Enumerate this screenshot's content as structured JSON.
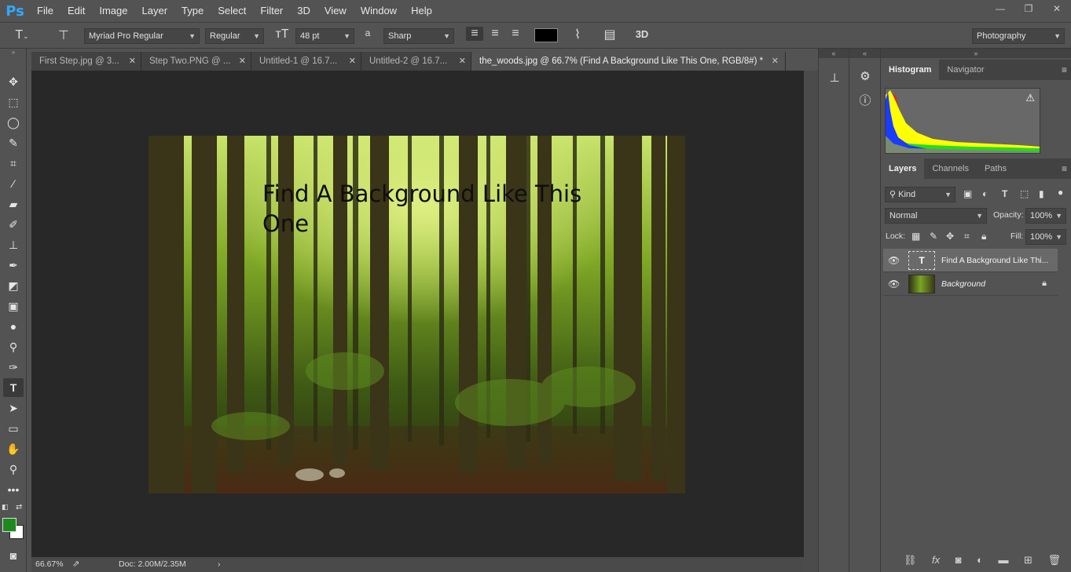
{
  "app": {
    "logo": "Ps"
  },
  "menu": [
    "File",
    "Edit",
    "Image",
    "Layer",
    "Type",
    "Select",
    "Filter",
    "3D",
    "View",
    "Window",
    "Help"
  ],
  "window_controls": {
    "minimize": "—",
    "restore": "❐",
    "close": "✕"
  },
  "options_bar": {
    "font_family": "Myriad Pro Regular",
    "font_style": "Regular",
    "font_size": "48 pt",
    "antialias_icon_label": "a",
    "antialias": "Sharp",
    "text_color": "#000000",
    "workspace": "Photography",
    "three_d": "3D"
  },
  "tabs": [
    {
      "label": "First Step.jpg @ 3...",
      "active": false
    },
    {
      "label": "Step Two.PNG @ ...",
      "active": false
    },
    {
      "label": "Untitled-1 @ 16.7...",
      "active": false
    },
    {
      "label": "Untitled-2 @ 16.7...",
      "active": false
    },
    {
      "label": "the_woods.jpg @ 66.7% (Find A Background Like This One, RGB/8#) *",
      "active": true
    }
  ],
  "document": {
    "text_line1": "Find A Background Like This",
    "text_line2": "One"
  },
  "status": {
    "zoom": "66.67%",
    "doc": "Doc: 2.00M/2.35M"
  },
  "panels": {
    "top_tabs": [
      "Histogram",
      "Navigator"
    ],
    "layer_tabs": [
      "Layers",
      "Channels",
      "Paths"
    ],
    "filter_kind": "Kind",
    "blend_mode": "Normal",
    "opacity_label": "Opacity:",
    "opacity": "100%",
    "lock_label": "Lock:",
    "fill_label": "Fill:",
    "fill": "100%",
    "layers": [
      {
        "name": "Find A Background Like Thi...",
        "type": "text",
        "selected": true
      },
      {
        "name": "Background",
        "type": "image",
        "selected": false,
        "locked": true
      }
    ]
  },
  "colors": {
    "foreground": "#1e8a1e",
    "background": "#ffffff",
    "accent": "#31a8ff"
  }
}
